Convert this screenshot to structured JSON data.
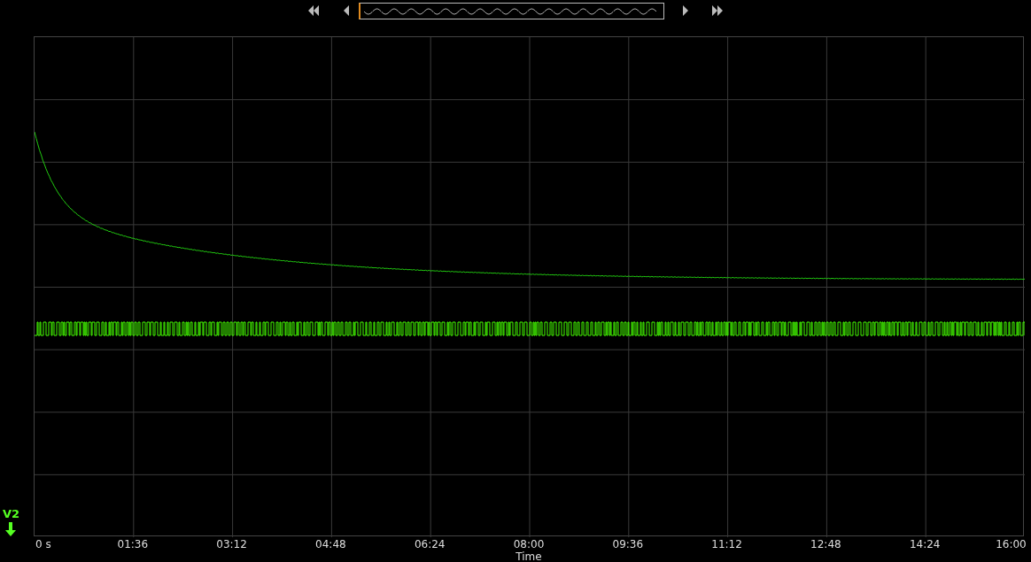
{
  "channel": {
    "label": "V2"
  },
  "x_axis": {
    "ticks": [
      "0 s",
      "01:36",
      "03:12",
      "04:48",
      "06:24",
      "08:00",
      "09:36",
      "11:12",
      "12:48",
      "14:24",
      "16:00"
    ],
    "label": "Time"
  }
}
